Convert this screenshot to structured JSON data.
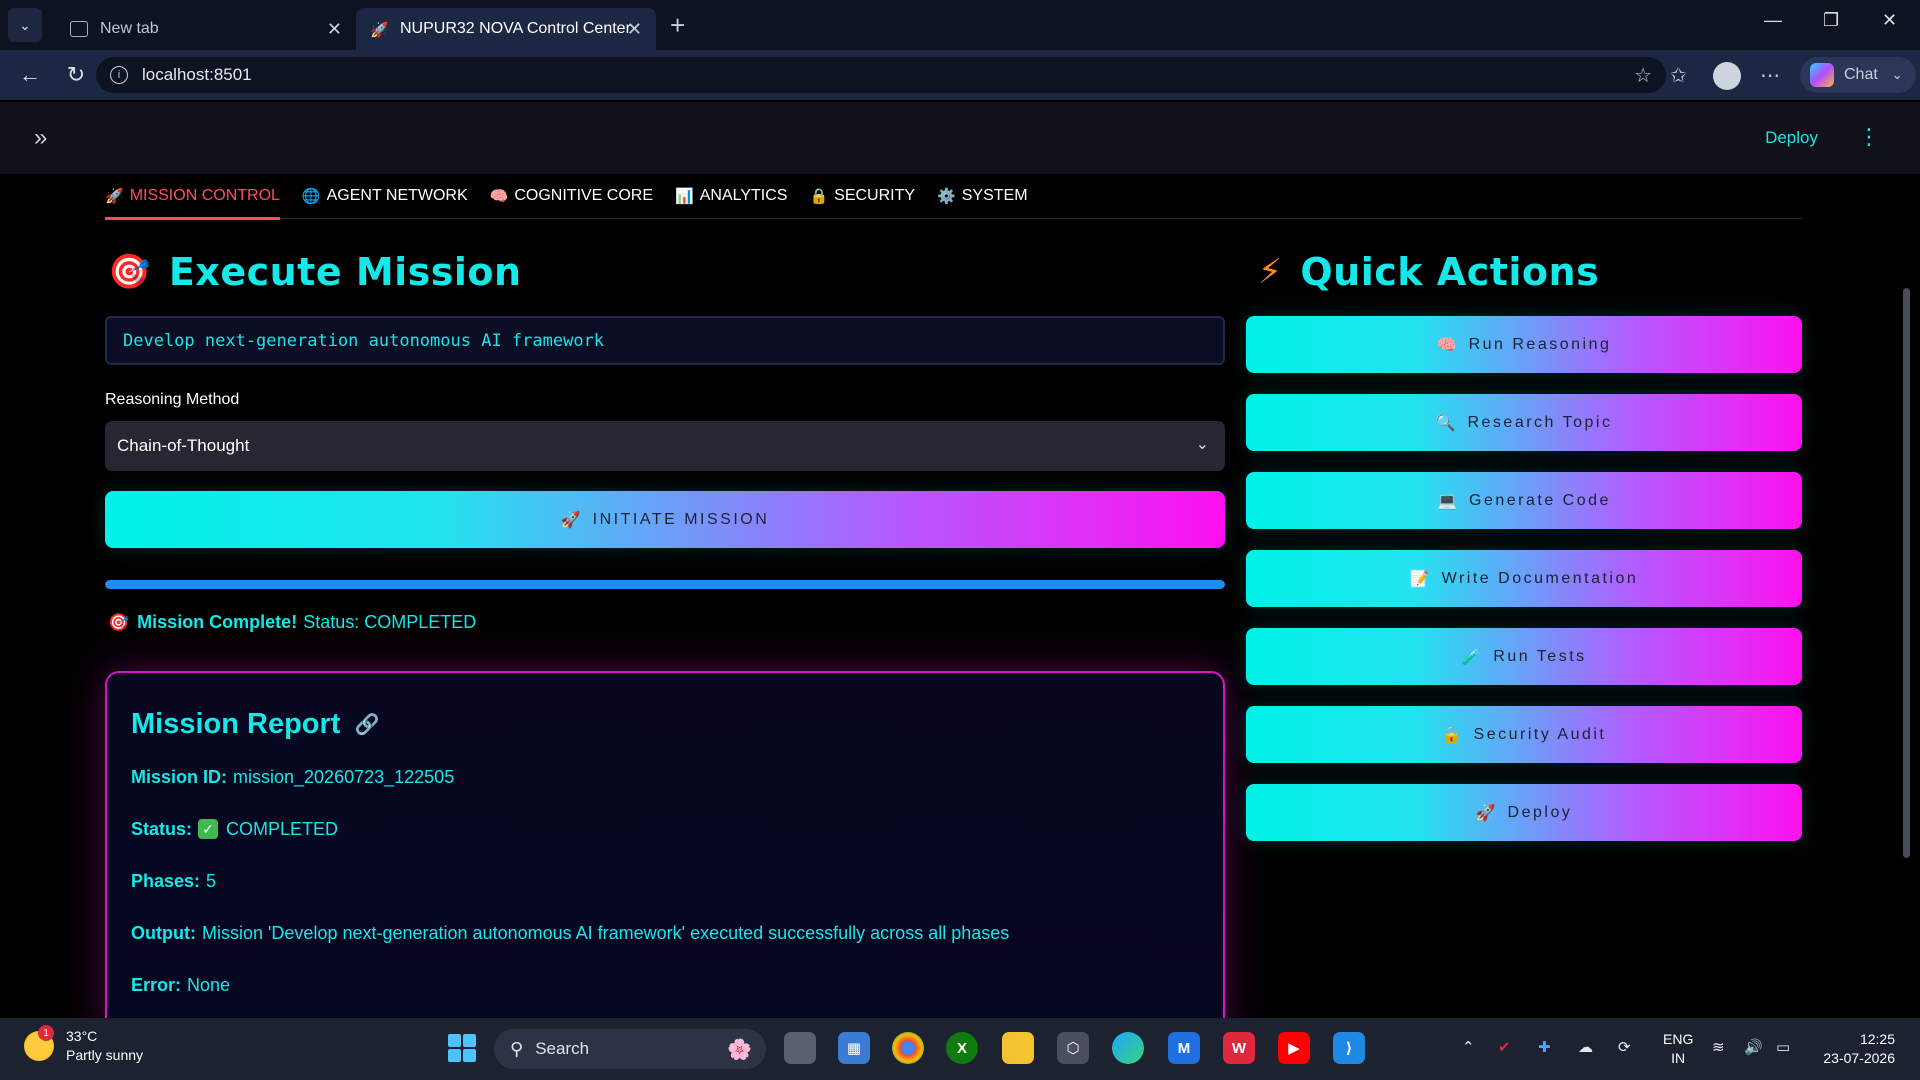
{
  "browser": {
    "tabs": [
      {
        "label": "New tab",
        "active": false
      },
      {
        "label": "NUPUR32 NOVA Control Center",
        "active": true
      }
    ],
    "url": "localhost:8501",
    "chat_label": "Chat"
  },
  "app": {
    "deploy_label": "Deploy",
    "tabs": [
      {
        "icon": "🚀",
        "label": "MISSION CONTROL"
      },
      {
        "icon": "🌐",
        "label": "AGENT NETWORK"
      },
      {
        "icon": "🧠",
        "label": "COGNITIVE CORE"
      },
      {
        "icon": "📊",
        "label": "ANALYTICS"
      },
      {
        "icon": "🔒",
        "label": "SECURITY"
      },
      {
        "icon": "⚙️",
        "label": "SYSTEM"
      }
    ],
    "execute": {
      "title_icon": "🎯",
      "title": "Execute Mission",
      "input_value": "Develop next-generation autonomous AI framework",
      "reasoning_label": "Reasoning Method",
      "reasoning_value": "Chain-of-Thought",
      "initiate_icon": "🚀",
      "initiate_label": "INITIATE MISSION",
      "progress": 100,
      "status_icon": "🎯",
      "status_bold": "Mission Complete!",
      "status_text": "Status: COMPLETED"
    },
    "report": {
      "title": "Mission Report",
      "mission_id_label": "Mission ID:",
      "mission_id": "mission_20260723_122505",
      "status_label": "Status:",
      "status_value": "COMPLETED",
      "phases_label": "Phases:",
      "phases_value": "5",
      "output_label": "Output:",
      "output_value": "Mission 'Develop next-generation autonomous AI framework' executed successfully across all phases",
      "error_label": "Error:",
      "error_value": "None"
    },
    "quick_actions": {
      "title_icon": "⚡",
      "title": "Quick Actions",
      "buttons": [
        {
          "icon": "🧠",
          "label": "Run Reasoning"
        },
        {
          "icon": "🔍",
          "label": "Research Topic"
        },
        {
          "icon": "💻",
          "label": "Generate Code"
        },
        {
          "icon": "📝",
          "label": "Write Documentation"
        },
        {
          "icon": "🧪",
          "label": "Run Tests"
        },
        {
          "icon": "🔒",
          "label": "Security Audit"
        },
        {
          "icon": "🚀",
          "label": "Deploy"
        }
      ]
    }
  },
  "taskbar": {
    "weather_temp": "33°C",
    "weather_desc": "Partly sunny",
    "weather_badge": "1",
    "search_label": "Search",
    "lang_line1": "ENG",
    "lang_line2": "IN",
    "time": "12:25",
    "date": "23-07-2026"
  },
  "colors": {
    "accent_cyan": "#14e8e8",
    "accent_magenta": "#ff10ee",
    "active_tab_red": "#ff4d5e",
    "progress_blue": "#1e8cf0"
  }
}
